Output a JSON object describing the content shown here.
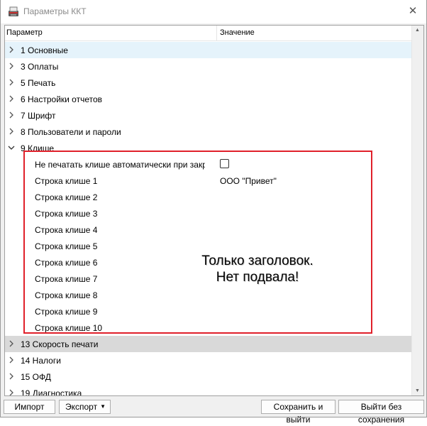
{
  "window": {
    "title": "Параметры ККТ"
  },
  "grid": {
    "columns": [
      "Параметр",
      "Значение"
    ],
    "groups_top": [
      {
        "label": "1 Основные",
        "state": "collapsed",
        "selected": true
      },
      {
        "label": "3 Оплаты",
        "state": "collapsed"
      },
      {
        "label": "5 Печать",
        "state": "collapsed"
      },
      {
        "label": "6 Настройки отчетов",
        "state": "collapsed"
      },
      {
        "label": "7 Шрифт",
        "state": "collapsed"
      },
      {
        "label": "8 Пользователи и пароли",
        "state": "collapsed"
      }
    ],
    "expanded_group": {
      "label": "9 Клише",
      "state": "expanded",
      "children": [
        {
          "label": "Не печатать клише автоматически при закр...",
          "value": "",
          "type": "checkbox",
          "checked": false
        },
        {
          "label": "Строка клише 1",
          "value": "ООО \"Привет\""
        },
        {
          "label": "Строка клише 2",
          "value": ""
        },
        {
          "label": "Строка клише 3",
          "value": ""
        },
        {
          "label": "Строка клише 4",
          "value": ""
        },
        {
          "label": "Строка клише 5",
          "value": ""
        },
        {
          "label": "Строка клише 6",
          "value": ""
        },
        {
          "label": "Строка клише 7",
          "value": ""
        },
        {
          "label": "Строка клише 8",
          "value": ""
        },
        {
          "label": "Строка клише 9",
          "value": ""
        },
        {
          "label": "Строка клише 10",
          "value": ""
        }
      ]
    },
    "groups_bottom": [
      {
        "label": "13 Скорость печати",
        "state": "collapsed",
        "hover": true
      },
      {
        "label": "14 Налоги",
        "state": "collapsed"
      },
      {
        "label": "15 ОФД",
        "state": "collapsed"
      },
      {
        "label": "19 Диагностика",
        "state": "collapsed"
      }
    ]
  },
  "annotation": {
    "line1": "Только заголовок.",
    "line2": "Нет подвала!",
    "color": "#e0202a"
  },
  "buttons": {
    "import": "Импорт",
    "export": "Экспорт",
    "save_exit": "Сохранить и выйти",
    "exit_nosave": "Выйти без сохранения"
  },
  "colors": {
    "selection": "#e5f3fb",
    "hover": "#d9d9d9",
    "highlight_box": "#e0202a"
  }
}
